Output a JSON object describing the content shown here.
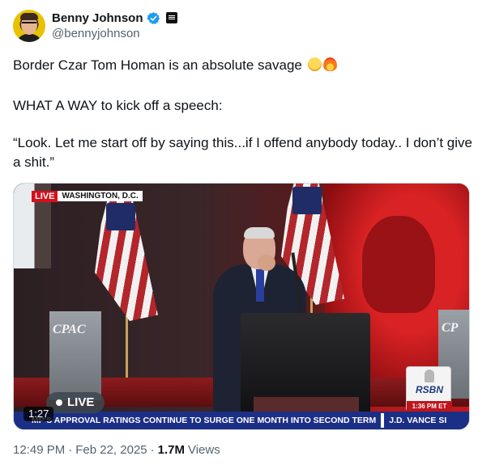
{
  "author": {
    "display_name": "Benny Johnson",
    "handle": "@bennyjohnson",
    "avatar_icon": "avatar-photo",
    "verified_icon": "verified-badge-icon",
    "affiliation_icon": "affiliation-badge-icon"
  },
  "tweet": {
    "line1": "Border Czar Tom Homan is an absolute savage",
    "line2": "WHAT A WAY to kick off a speech:",
    "line3": "“Look. Let me start off by saying this...if I offend anybody today.. I don’t give a shit.”",
    "emojis": [
      "rolling-on-floor-laughing-emoji",
      "fire-emoji"
    ]
  },
  "video": {
    "live_label": "LIVE",
    "location": "WASHINGTON, D.C.",
    "cpac_left": "CPAC",
    "cpac_right": "CP",
    "network": "RSBN",
    "network_time": "1:36 PM ET",
    "ticker_text": "MP'S APPROVAL RATINGS CONTINUE TO SURGE ONE MONTH INTO SECOND TERM",
    "ticker_text2": "J.D. VANCE SI",
    "live_pill": "LIVE",
    "duration": "1:27"
  },
  "meta": {
    "time": "12:49 PM",
    "sep1": "·",
    "date": "Feb 22, 2025",
    "sep2": "·",
    "views_count": "1.7M",
    "views_label": "Views"
  },
  "colors": {
    "verified": "#1d9bf0",
    "text": "#0f1419",
    "secondary": "#536471",
    "ticker": "#1c2f86",
    "live_red": "#d6101a"
  }
}
